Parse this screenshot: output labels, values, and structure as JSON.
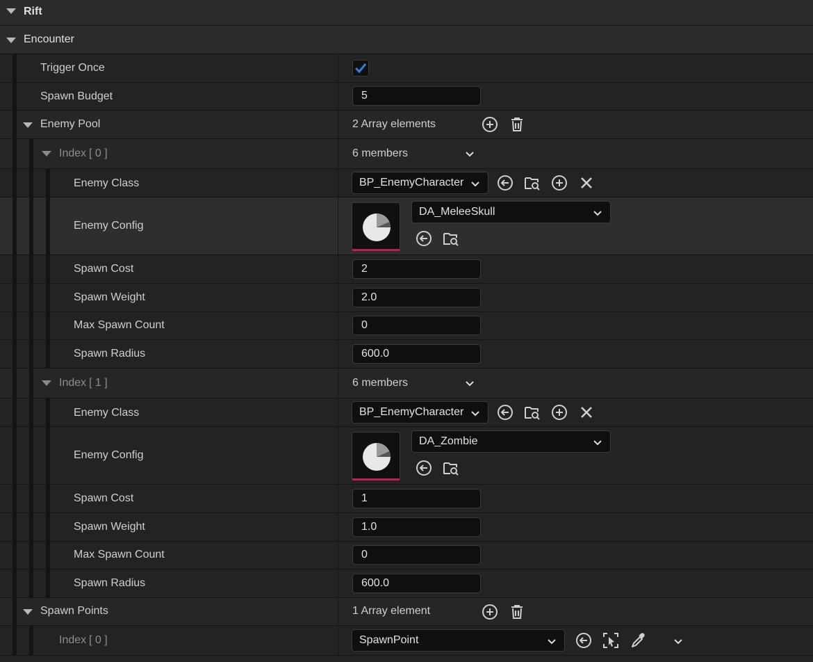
{
  "categories": {
    "rift": "Rift",
    "encounter": "Encounter"
  },
  "trigger_once": {
    "label": "Trigger Once",
    "checked": true
  },
  "spawn_budget": {
    "label": "Spawn Budget",
    "value": "5"
  },
  "enemy_pool": {
    "label": "Enemy Pool",
    "count": "2 Array elements",
    "items": [
      {
        "index_word": "Index",
        "index": "[ 0 ]",
        "members": "6 members",
        "enemy_class_label": "Enemy Class",
        "enemy_class": "BP_EnemyCharacter",
        "enemy_config_label": "Enemy Config",
        "enemy_config": "DA_MeleeSkull",
        "spawn_cost_label": "Spawn Cost",
        "spawn_cost": "2",
        "spawn_weight_label": "Spawn Weight",
        "spawn_weight": "2.0",
        "max_spawn_count_label": "Max Spawn Count",
        "max_spawn_count": "0",
        "spawn_radius_label": "Spawn Radius",
        "spawn_radius": "600.0"
      },
      {
        "index_word": "Index",
        "index": "[ 1 ]",
        "members": "6 members",
        "enemy_class_label": "Enemy Class",
        "enemy_class": "BP_EnemyCharacter",
        "enemy_config_label": "Enemy Config",
        "enemy_config": "DA_Zombie",
        "spawn_cost_label": "Spawn Cost",
        "spawn_cost": "1",
        "spawn_weight_label": "Spawn Weight",
        "spawn_weight": "1.0",
        "max_spawn_count_label": "Max Spawn Count",
        "max_spawn_count": "0",
        "spawn_radius_label": "Spawn Radius",
        "spawn_radius": "600.0"
      }
    ]
  },
  "spawn_points": {
    "label": "Spawn Points",
    "count": "1 Array element",
    "items": [
      {
        "index_word": "Index",
        "index": "[ 0 ]",
        "value": "SpawnPoint"
      }
    ]
  },
  "colors": {
    "accent_check": "#2f7fe0",
    "asset_bar": "#c21d5a",
    "panel": "#232323",
    "field_bg": "#0f0f0f"
  },
  "icons": [
    "collapse-arrow-icon",
    "checkmark-icon",
    "add-element-icon",
    "delete-icon",
    "chevron-down-icon",
    "use-selected-icon",
    "browse-icon",
    "clear-icon",
    "data-asset-icon",
    "select-actor-icon",
    "eyedropper-icon"
  ]
}
